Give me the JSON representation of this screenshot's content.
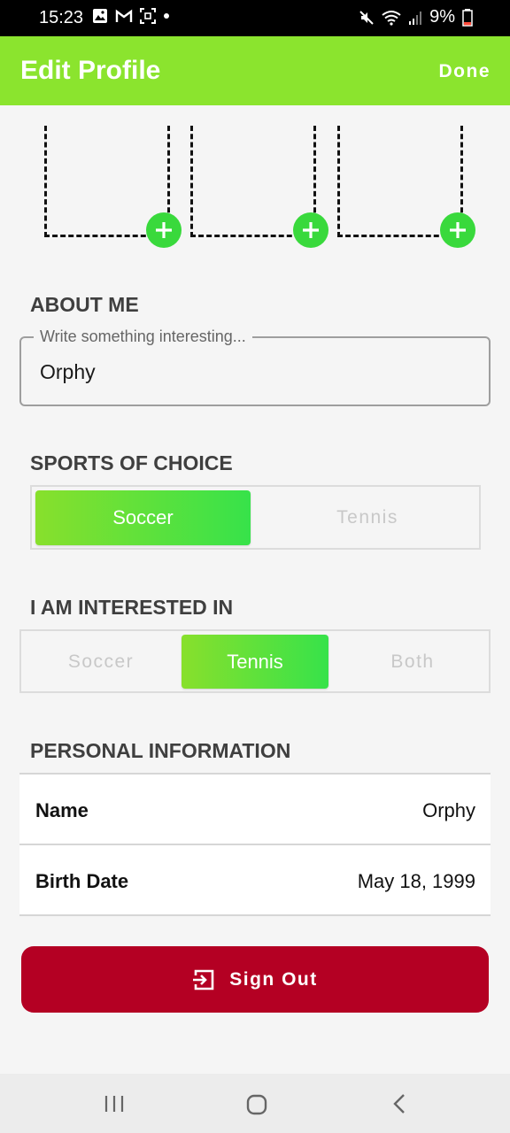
{
  "status_bar": {
    "time": "15:23",
    "battery": "9%",
    "icons": [
      "gallery-icon",
      "gmail-icon",
      "screenshot-icon",
      "dot-icon",
      "mute-icon",
      "wifi-icon",
      "signal-icon",
      "battery-icon"
    ]
  },
  "app_bar": {
    "title": "Edit Profile",
    "done_label": "Done",
    "color": "#8be42e"
  },
  "photos": {
    "slots": 3,
    "add_icon": "plus-icon",
    "add_color": "#39d93c"
  },
  "about": {
    "heading": "ABOUT ME",
    "placeholder": "Write something interesting...",
    "value": "Orphy"
  },
  "sports": {
    "heading": "SPORTS OF CHOICE",
    "options": [
      "Soccer",
      "Tennis"
    ],
    "selected": "Soccer"
  },
  "interests": {
    "heading": "I AM INTERESTED IN",
    "options": [
      "Soccer",
      "Tennis",
      "Both"
    ],
    "selected": "Tennis"
  },
  "personal": {
    "heading": "PERSONAL INFORMATION",
    "rows": [
      {
        "label": "Name",
        "value": "Orphy"
      },
      {
        "label": "Birth Date",
        "value": "May 18, 1999"
      }
    ]
  },
  "sign_out": {
    "label": "Sign Out",
    "icon": "exit-icon",
    "color": "#b40023"
  },
  "nav_bar": {
    "icons": [
      "recent-apps-icon",
      "home-icon",
      "back-icon"
    ]
  }
}
